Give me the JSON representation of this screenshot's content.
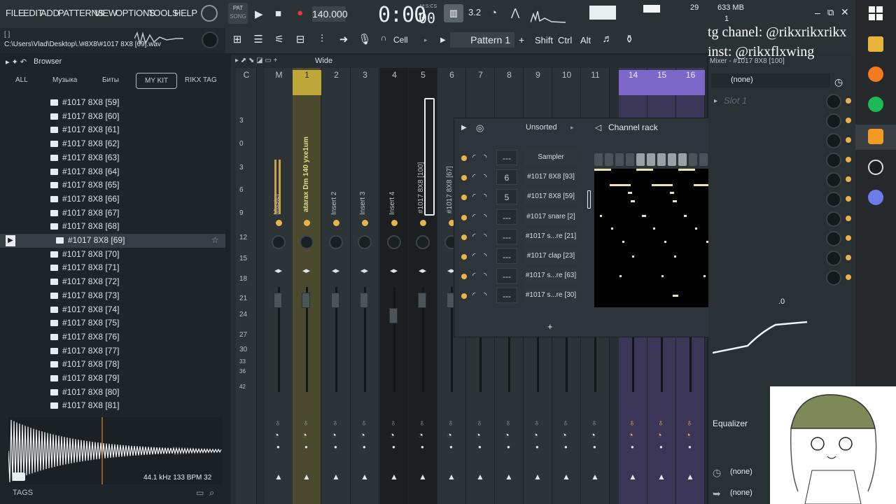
{
  "menu": [
    "FILE",
    "EDIT",
    "ADD",
    "PATTERNS",
    "VIEW",
    "OPTIONS",
    "TOOLS",
    "HELP"
  ],
  "transport": {
    "mode_top": "PAT",
    "mode_bottom": "SONG",
    "tempo": "140.000",
    "time": "0:00",
    "time_sub": "00",
    "time_unit": "M:S:CS",
    "cpu": "29",
    "memory": "633 MB",
    "voices": "1",
    "pattern": "Pattern 1",
    "snap": "Cell",
    "keys": [
      "Shift",
      "Ctrl",
      "Alt"
    ]
  },
  "hint_bar": {
    "bracket": "[ ]",
    "path": "C:\\Users\\Vlad\\Desktop\\.\\#8X8\\#1017 8X8 [69].wav"
  },
  "browser": {
    "title": "Browser",
    "tabs": [
      "ALL",
      "Музыка",
      "Биты",
      "MY KIT",
      "RIKX TAG"
    ],
    "items": [
      "#1017 8X8 [59]",
      "#1017 8X8 [60]",
      "#1017 8X8 [61]",
      "#1017 8X8 [62]",
      "#1017 8X8 [63]",
      "#1017 8X8 [64]",
      "#1017 8X8 [65]",
      "#1017 8X8 [66]",
      "#1017 8X8 [67]",
      "#1017 8X8 [68]",
      "#1017 8X8 [69]",
      "#1017 8X8 [70]",
      "#1017 8X8 [71]",
      "#1017 8X8 [72]",
      "#1017 8X8 [73]",
      "#1017 8X8 [74]",
      "#1017 8X8 [75]",
      "#1017 8X8 [76]",
      "#1017 8X8 [77]",
      "#1017 8X8 [78]",
      "#1017 8X8 [79]",
      "#1017 8X8 [80]",
      "#1017 8X8 [81]"
    ],
    "selected_index": 10,
    "sample_info": "44.1 kHz 133 BPM 32",
    "tags_label": "TAGS"
  },
  "mixer": {
    "view": "Wide",
    "title": "Mixer - #1017 8X8 [100]",
    "headers": [
      "C",
      "M",
      "1",
      "2",
      "3",
      "4",
      "5",
      "6",
      "7",
      "8",
      "9",
      "10",
      "11",
      "14",
      "15",
      "16"
    ],
    "db_scale": [
      "3",
      "0",
      "3",
      "6",
      "9",
      "12",
      "15",
      "18",
      "21",
      "24",
      "27",
      "30",
      "33",
      "36",
      "42"
    ],
    "insert_names": [
      "Master",
      "atarax Dm 140 yxe1um",
      "Insert 2",
      "Insert 3",
      "Insert 4",
      "#1017 8X8 [100]",
      "#1017 8X8 [67]"
    ],
    "slot_none": "(none)",
    "slot_1": "Slot 1",
    "equalizer": "Equalizer",
    "eq_value": ".0"
  },
  "channel_rack": {
    "title": "Channel rack",
    "filter": "Unsorted",
    "channels": [
      {
        "num": "---",
        "name": "Sampler"
      },
      {
        "num": "6",
        "name": "#1017 8X8 [93]"
      },
      {
        "num": "5",
        "name": "#1017 8X8 [59]"
      },
      {
        "num": "---",
        "name": "#1017 snare [2]"
      },
      {
        "num": "---",
        "name": "#1017 s...re [21]"
      },
      {
        "num": "---",
        "name": "#1017 clap [23]"
      },
      {
        "num": "---",
        "name": "#1017 s...re [63]"
      },
      {
        "num": "---",
        "name": "#1017 s...re [30]"
      }
    ],
    "add_label": "+"
  },
  "overlay": {
    "line1": "tg chanel: @rikxrikxrikx",
    "line2": "inst: @rikxflxwing"
  },
  "colors": {
    "accent_yellow": "#bfa83a",
    "accent_purple": "#7b68c8",
    "led": "#e6b44b",
    "note": "#ece3b0"
  }
}
